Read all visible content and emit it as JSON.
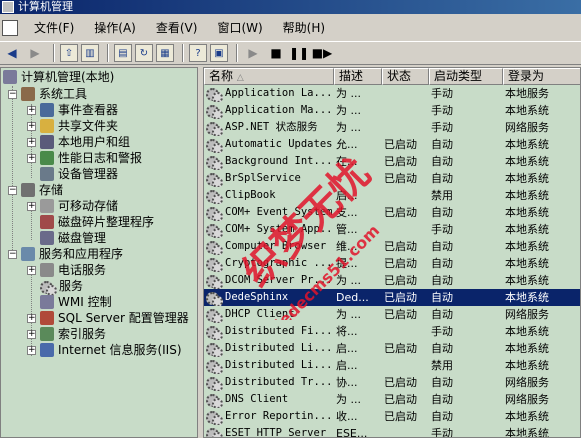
{
  "title": "计算机管理",
  "menu": [
    "文件(F)",
    "操作(A)",
    "查看(V)",
    "窗口(W)",
    "帮助(H)"
  ],
  "tree": {
    "root": "计算机管理(本地)",
    "system_tools": "系统工具",
    "event_viewer": "事件查看器",
    "shared_folders": "共享文件夹",
    "local_users": "本地用户和组",
    "perf_logs": "性能日志和警报",
    "device_manager": "设备管理器",
    "storage": "存储",
    "removable": "可移动存储",
    "defrag": "磁盘碎片整理程序",
    "disk_mgmt": "磁盘管理",
    "services_apps": "服务和应用程序",
    "telephony": "电话服务",
    "services": "服务",
    "wmi": "WMI 控制",
    "sql_server": "SQL Server 配置管理器",
    "indexing": "索引服务",
    "iis": "Internet 信息服务(IIS)"
  },
  "columns": [
    "名称",
    "描述",
    "状态",
    "启动类型",
    "登录为"
  ],
  "rows": [
    {
      "name": "Application La...",
      "desc": "为 ...",
      "status": "",
      "startup": "手动",
      "logon": "本地服务"
    },
    {
      "name": "Application Ma...",
      "desc": "为 ...",
      "status": "",
      "startup": "手动",
      "logon": "本地系统"
    },
    {
      "name": "ASP.NET 状态服务",
      "desc": "为 ...",
      "status": "",
      "startup": "手动",
      "logon": "网络服务"
    },
    {
      "name": "Automatic Updates",
      "desc": "允...",
      "status": "已启动",
      "startup": "自动",
      "logon": "本地系统"
    },
    {
      "name": "Background Int...",
      "desc": "在...",
      "status": "已启动",
      "startup": "自动",
      "logon": "本地系统"
    },
    {
      "name": "BrSplService",
      "desc": "",
      "status": "已启动",
      "startup": "自动",
      "logon": "本地系统"
    },
    {
      "name": "ClipBook",
      "desc": "启...",
      "status": "",
      "startup": "禁用",
      "logon": "本地系统"
    },
    {
      "name": "COM+ Event System",
      "desc": "支...",
      "status": "已启动",
      "startup": "自动",
      "logon": "本地系统"
    },
    {
      "name": "COM+ System App...",
      "desc": "管...",
      "status": "",
      "startup": "手动",
      "logon": "本地系统"
    },
    {
      "name": "Computer Browser",
      "desc": "维...",
      "status": "已启动",
      "startup": "自动",
      "logon": "本地系统"
    },
    {
      "name": "Cryptographic ...",
      "desc": "提...",
      "status": "已启动",
      "startup": "自动",
      "logon": "本地系统"
    },
    {
      "name": "DCOM Server Pr...",
      "desc": "为 ...",
      "status": "已启动",
      "startup": "自动",
      "logon": "本地系统"
    },
    {
      "name": "DedeSphinx",
      "desc": "Ded...",
      "status": "已启动",
      "startup": "自动",
      "logon": "本地系统",
      "selected": true
    },
    {
      "name": "DHCP Client",
      "desc": "为 ...",
      "status": "已启动",
      "startup": "自动",
      "logon": "网络服务"
    },
    {
      "name": "Distributed Fi...",
      "desc": "将...",
      "status": "",
      "startup": "手动",
      "logon": "本地系统"
    },
    {
      "name": "Distributed Li...",
      "desc": "启...",
      "status": "已启动",
      "startup": "自动",
      "logon": "本地系统"
    },
    {
      "name": "Distributed Li...",
      "desc": "启...",
      "status": "",
      "startup": "禁用",
      "logon": "本地系统"
    },
    {
      "name": "Distributed Tr...",
      "desc": "协...",
      "status": "已启动",
      "startup": "自动",
      "logon": "网络服务"
    },
    {
      "name": "DNS Client",
      "desc": "为 ...",
      "status": "已启动",
      "startup": "自动",
      "logon": "网络服务"
    },
    {
      "name": "Error Reportin...",
      "desc": "收...",
      "status": "已启动",
      "startup": "自动",
      "logon": "本地系统"
    },
    {
      "name": "ESET HTTP Server",
      "desc": "ESE...",
      "status": "",
      "startup": "手动",
      "logon": "本地系统"
    }
  ],
  "watermark": {
    "main": "织梦无忧",
    "url": "dedecms51.com"
  },
  "colors": {
    "pane_bg": "#c8dcc8",
    "selection": "#0a246a",
    "watermark": "#e0142a"
  }
}
